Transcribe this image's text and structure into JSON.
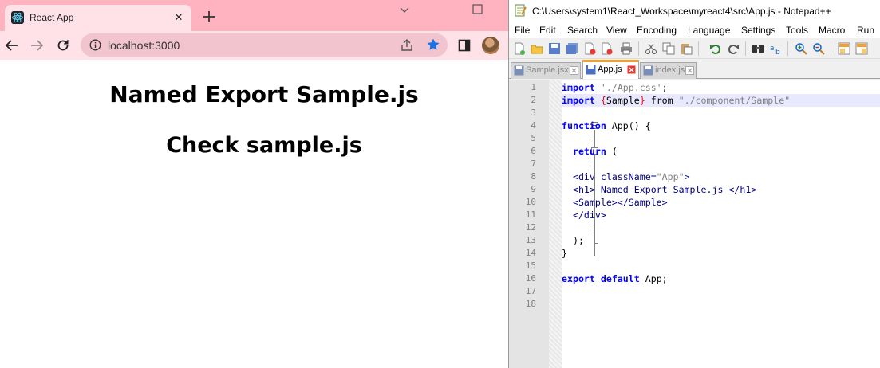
{
  "browser": {
    "tab_title": "React App",
    "tab_close": "✕",
    "url": "localhost:3000"
  },
  "page": {
    "heading": "Named Export Sample.js",
    "subheading": "Check sample.js"
  },
  "notepad": {
    "title": "C:\\Users\\system1\\React_Workspace\\myreact4\\src\\App.js - Notepad++",
    "menu": [
      "File",
      "Edit",
      "Search",
      "View",
      "Encoding",
      "Language",
      "Settings",
      "Tools",
      "Macro",
      "Run"
    ],
    "tabs": [
      "Sample.jsx",
      "App.js",
      "index.js"
    ],
    "line_numbers": [
      "1",
      "2",
      "3",
      "4",
      "5",
      "6",
      "7",
      "8",
      "9",
      "10",
      "11",
      "12",
      "13",
      "14",
      "15",
      "16",
      "17",
      "18"
    ],
    "code": {
      "l1_kw": "import",
      "l1_str": "'./App.css'",
      "l1_end": ";",
      "l2_kw": "import",
      "l2_lb": "{",
      "l2_name": "Sample",
      "l2_rb": "}",
      "l2_from": "from",
      "l2_str": "\"./component/Sample\"",
      "l4_kw": "function",
      "l4_rest": " App() {",
      "l6_kw": "return",
      "l6_rest": " (",
      "l8_open": "<div className=",
      "l8_str": "\"App\"",
      "l8_close": ">",
      "l9": "<h1> Named Export Sample.js </h1>",
      "l10": "<Sample></Sample>",
      "l11": "</div>",
      "l13": ");",
      "l14": "}",
      "l16_kw1": "export",
      "l16_kw2": "default",
      "l16_rest": " App;"
    }
  },
  "colors": {
    "chrome_tabstrip": "#ffb3c0",
    "chrome_toolbar": "#ffe2e8",
    "npp_active_tab_accent": "#f3a02d",
    "code_keyword": "#0000ff",
    "code_string": "#808080"
  }
}
